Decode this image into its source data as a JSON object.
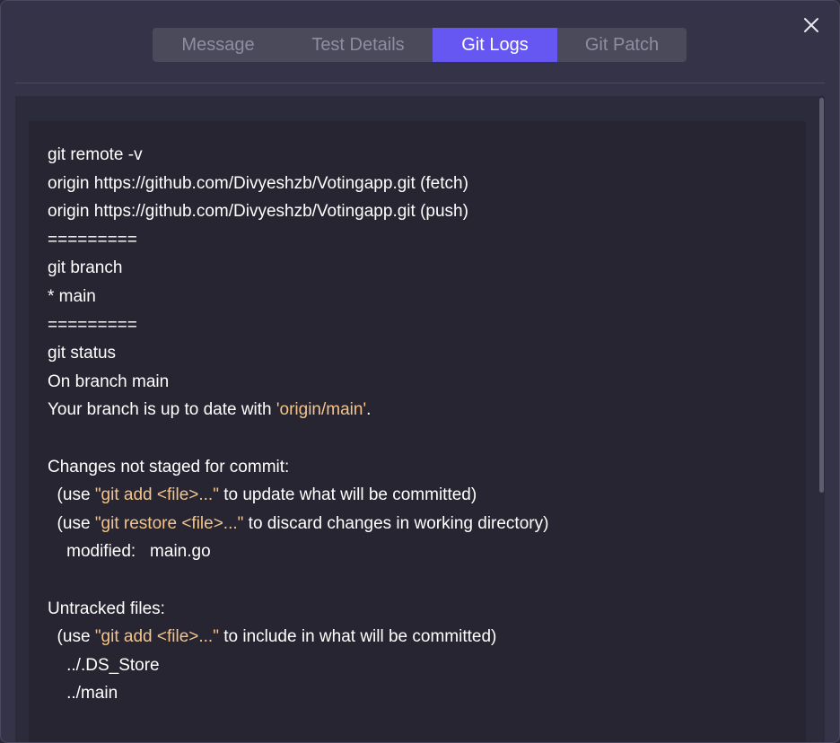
{
  "dialog": {
    "close_icon": "close-icon",
    "tabs": [
      {
        "label": "Message",
        "active": false
      },
      {
        "label": "Test Details",
        "active": false
      },
      {
        "label": "Git Logs",
        "active": true
      },
      {
        "label": "Git Patch",
        "active": false
      }
    ]
  },
  "colors": {
    "active_tab": "#6656f2",
    "highlight_text": "#f4c48c",
    "log_background": "#262531"
  },
  "log": {
    "lines": [
      [
        {
          "text": "git remote -v"
        }
      ],
      [
        {
          "text": "origin https://github.com/Divyeshzb/Votingapp.git (fetch)"
        }
      ],
      [
        {
          "text": "origin https://github.com/Divyeshzb/Votingapp.git (push)"
        }
      ],
      [
        {
          "text": "========="
        }
      ],
      [
        {
          "text": "git branch"
        }
      ],
      [
        {
          "text": "* main"
        }
      ],
      [
        {
          "text": "========="
        }
      ],
      [
        {
          "text": "git status"
        }
      ],
      [
        {
          "text": "On branch main"
        }
      ],
      [
        {
          "text": "Your branch is up to date with "
        },
        {
          "text": "'origin/main'",
          "hl": true
        },
        {
          "text": "."
        }
      ],
      [
        {
          "text": ""
        }
      ],
      [
        {
          "text": "Changes not staged for commit:"
        }
      ],
      [
        {
          "text": "  (use "
        },
        {
          "text": "\"git add <file>...\"",
          "hl": true
        },
        {
          "text": " to update what will be committed)"
        }
      ],
      [
        {
          "text": "  (use "
        },
        {
          "text": "\"git restore <file>...\"",
          "hl": true
        },
        {
          "text": " to discard changes in working directory)"
        }
      ],
      [
        {
          "text": "    modified:   main.go"
        }
      ],
      [
        {
          "text": ""
        }
      ],
      [
        {
          "text": "Untracked files:"
        }
      ],
      [
        {
          "text": "  (use "
        },
        {
          "text": "\"git add <file>...\"",
          "hl": true
        },
        {
          "text": " to include in what will be committed)"
        }
      ],
      [
        {
          "text": "    ../.DS_Store"
        }
      ],
      [
        {
          "text": "    ../main"
        }
      ]
    ]
  }
}
